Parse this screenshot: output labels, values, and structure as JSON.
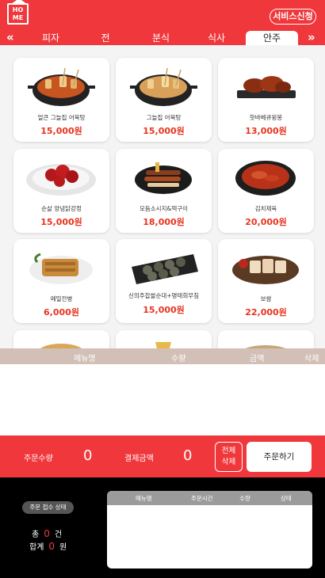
{
  "header": {
    "logo_top": "HO",
    "logo_bottom": "ME",
    "service_button": "서비스신청",
    "prev_arrow": "«",
    "next_arrow": "»",
    "tabs": [
      {
        "label": "피자"
      },
      {
        "label": "전"
      },
      {
        "label": "분식"
      },
      {
        "label": "식사"
      },
      {
        "label": "안주",
        "active": true
      }
    ]
  },
  "menu_items": [
    {
      "name": "얼큰 그늘집 어묵탕",
      "price": "15,000원"
    },
    {
      "name": "그늘집 어묵탕",
      "price": "15,000원"
    },
    {
      "name": "핫바베큐윙봉",
      "price": "13,000원"
    },
    {
      "name": "순살 양념닭강정",
      "price": "15,000원"
    },
    {
      "name": "모듬소시지&떡구이",
      "price": "18,000원"
    },
    {
      "name": "김치제육",
      "price": "20,000원"
    },
    {
      "name": "메밀전병",
      "price": "6,000원"
    },
    {
      "name": "신의주찹쌀순대+명태회무침",
      "price": "15,000원"
    },
    {
      "name": "보쌈",
      "price": "22,000원"
    }
  ],
  "order_list": {
    "col_name": "메뉴명",
    "col_qty": "수량",
    "col_amount": "금액",
    "col_delete": "삭제"
  },
  "summary": {
    "qty_label": "주문수량",
    "qty_value": "0",
    "amount_label": "결제금액",
    "amount_value": "0",
    "clear_line1": "전체",
    "clear_line2": "삭제",
    "order_button": "주문하기"
  },
  "status_panel": {
    "badge": "주문 접수 상태",
    "count_prefix": "총",
    "count_value": "0",
    "count_unit": "건",
    "sum_prefix": "합계",
    "sum_value": "0",
    "sum_unit": "원",
    "table_headers": [
      "메뉴명",
      "주문시간",
      "수량",
      "상태"
    ]
  },
  "colors": {
    "accent": "#f0383c",
    "price": "#e8341f",
    "list_header": "#d2bfb6"
  }
}
